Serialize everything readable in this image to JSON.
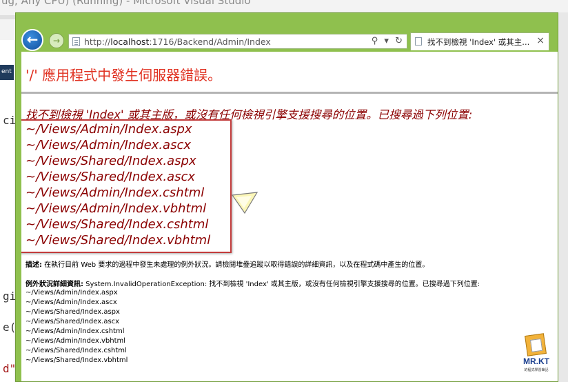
{
  "vs": {
    "title": "ug, Any CPU) (Running) - Microsoft Visual Studio",
    "gutter_label": "ent",
    "code_fragments": [
      "ci",
      "gi",
      "e(",
      "d\""
    ]
  },
  "browser": {
    "url_prefix": "http://",
    "url_host": "localhost",
    "url_rest": ":1716/Backend/Admin/Index",
    "search_symbol": "⚲",
    "dropdown_symbol": "▾",
    "refresh_symbol": "↻",
    "tab_title": "找不到檢視 'Index' 或其主...",
    "tab_close": "×",
    "back_symbol": "←",
    "forward_symbol": "→",
    "accent_color": "#8fc04e"
  },
  "page": {
    "error_title_app": "'/'",
    "error_title_text": " 應用程式中發生伺服器錯誤。",
    "error_message": "找不到檢視 'Index' 或其主版，或沒有任何檢視引擎支援搜尋的位置。已搜尋過下列位置:",
    "views": [
      "~/Views/Admin/Index.aspx",
      "~/Views/Admin/Index.ascx",
      "~/Views/Shared/Index.aspx",
      "~/Views/Shared/Index.ascx",
      "~/Views/Admin/Index.cshtml",
      "~/Views/Admin/Index.vbhtml",
      "~/Views/Shared/Index.cshtml",
      "~/Views/Shared/Index.vbhtml"
    ],
    "description_label": "描述:",
    "description_text": " 在執行目前 Web 要求的過程中發生未處理的例外狀況。請檢閱堆疊追蹤以取得錯誤的詳細資訊，以及在程式碼中產生的位置。",
    "exception_label": "例外狀況詳細資訊:",
    "exception_text": " System.InvalidOperationException: 找不到檢視 'Index' 或其主版，或沒有任何檢視引擎支援搜尋的位置。已搜尋過下列位置:",
    "exception_views": [
      "~/Views/Admin/Index.aspx",
      "~/Views/Admin/Index.ascx",
      "~/Views/Shared/Index.aspx",
      "~/Views/Shared/Index.ascx",
      "~/Views/Admin/Index.cshtml",
      "~/Views/Admin/Index.vbhtml",
      "~/Views/Shared/Index.cshtml",
      "~/Views/Shared/Index.vbhtml"
    ]
  },
  "watermark": {
    "brand": "MR.KT",
    "subtitle": "的程式學習筆記"
  }
}
